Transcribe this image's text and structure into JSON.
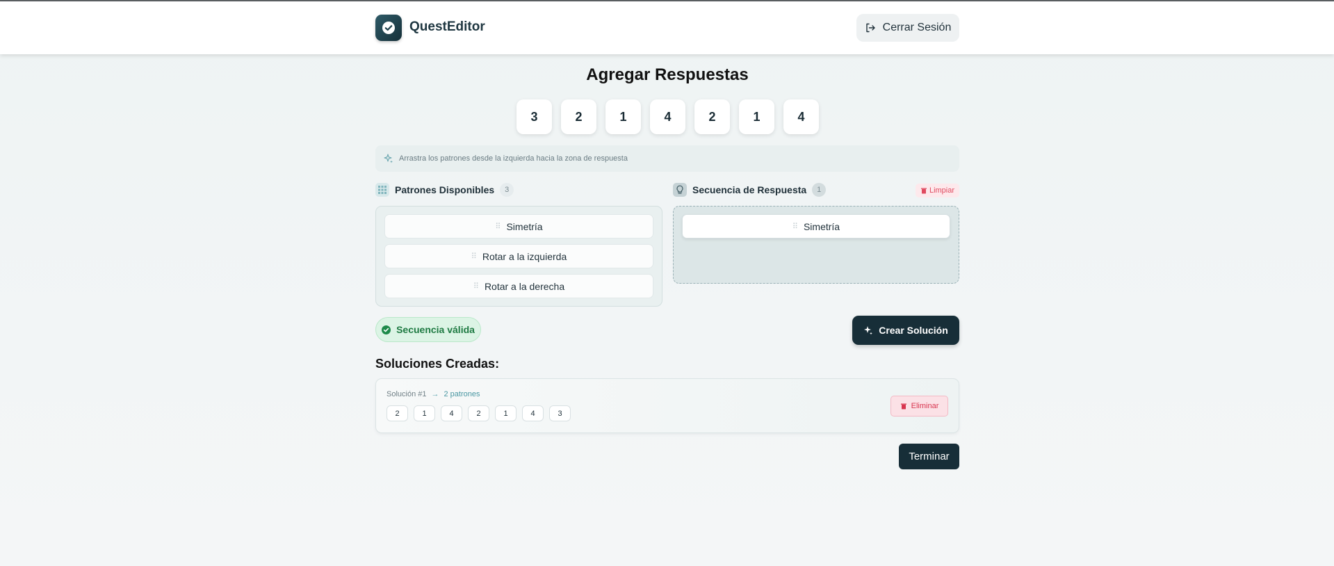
{
  "header": {
    "brand": "QuestEditor",
    "logout_label": "Cerrar Sesión"
  },
  "page": {
    "title": "Agregar Respuestas",
    "sequence": [
      "3",
      "2",
      "1",
      "4",
      "2",
      "1",
      "4"
    ],
    "hint": "Arrastra los patrones desde la izquierda hacia la zona de respuesta"
  },
  "available": {
    "title": "Patrones Disponibles",
    "count": "3",
    "items": [
      "Simetría",
      "Rotar a la izquierda",
      "Rotar a la derecha"
    ]
  },
  "answer": {
    "title": "Secuencia de Respuesta",
    "count": "1",
    "clear_label": "Limpiar",
    "items": [
      "Simetría"
    ]
  },
  "status": {
    "valid_label": "Secuencia válida",
    "create_label": "Crear Solución"
  },
  "solutions": {
    "title": "Soluciones Creadas:",
    "items": [
      {
        "label": "Solución #1",
        "patterns": "2 patrones",
        "values": [
          "2",
          "1",
          "4",
          "2",
          "1",
          "4",
          "3"
        ],
        "delete_label": "Eliminar"
      }
    ]
  },
  "footer": {
    "finish_label": "Terminar"
  },
  "colors": {
    "primary": "#172e38",
    "success": "#1e7a42",
    "danger": "#d8354f"
  }
}
